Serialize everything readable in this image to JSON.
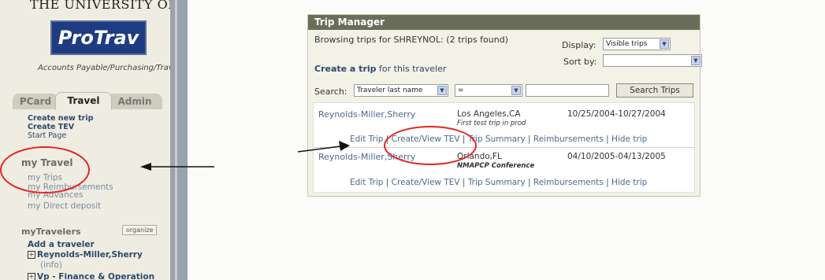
{
  "sidebar": {
    "university": "THE UNIVERSITY OF IOWA",
    "logo_text": "ProTrav",
    "tagline": "Accounts Payable/Purchasing/Travel",
    "tabs": [
      "PCard",
      "Travel",
      "Admin"
    ],
    "travel_links": [
      "Create new trip",
      "Create TEV",
      "Start Page"
    ],
    "my_travel_title": "my Travel",
    "my_links": [
      "my Trips",
      "my Reimbursements",
      "my Advances",
      "my Direct deposit"
    ],
    "my_travelers_title": "myTravelers",
    "organize_label": "organize",
    "add_traveler": "Add a traveler",
    "traveler_1": "Reynolds-Miller,Sherry",
    "traveler_1_info": "(info)",
    "traveler_2": "Vp - Finance & Operation"
  },
  "panel": {
    "title": "Trip Manager",
    "browsing": "Browsing trips for SHREYNOL: (2 trips found)",
    "create_link_bold": "Create a trip",
    "create_link_rest": " for this traveler",
    "display_label": "Display:",
    "display_value": "Visible trips",
    "sort_label": "Sort by:",
    "sort_value": "",
    "search_label": "Search:",
    "search_field": "Traveler last name",
    "search_op": "=",
    "search_value": "",
    "search_button": "Search Trips"
  },
  "trips": [
    {
      "traveler": "Reynolds-Miller,Sherry",
      "location": "Los Angeles,CA",
      "note": "First test trip in prod",
      "dates": "10/25/2004-10/27/2004",
      "actions": [
        "Edit Trip",
        "Create/View TEV",
        "Trip Summary",
        "Reimbursements",
        "Hide trip"
      ]
    },
    {
      "traveler": "Reynolds-Miller,Sherry",
      "location": "Orlando,FL",
      "note": "NMAPCP Conference",
      "dates": "04/10/2005-04/13/2005",
      "actions": [
        "Edit Trip",
        "Create/View TEV",
        "Trip Summary",
        "Reimbursements",
        "Hide trip"
      ]
    }
  ],
  "colors": {
    "annotation_red": "#e62323",
    "header_bg": "#6b6d5b",
    "logo_bg": "#1f3c82",
    "link_blue": "#4a6a8c"
  }
}
